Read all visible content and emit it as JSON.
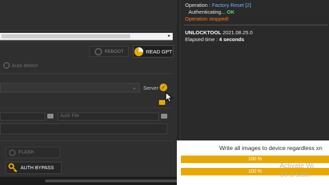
{
  "left_panel": {
    "reboot_label": "REBOOT",
    "read_gpt_label": "READ GPT",
    "auto_detect_label": "Auto detect",
    "server_label": "Server",
    "auth_file_placeholder": "Auth File",
    "flash_label": "FLASH",
    "auth_bypass_label": "AUTH BYPASS"
  },
  "log": {
    "operation_label": "Operation : ",
    "operation_value": "Factory Reset [2]",
    "authenticating_label": "Authenticating... ",
    "authenticating_status": "OK",
    "stopped_message": "Operation stopped!",
    "tool_name": "UNLOCKTOOL",
    "tool_version": " 2021.08.25.0",
    "elapsed_label": "Elapsed time : ",
    "elapsed_value": "4 seconds"
  },
  "status": {
    "message": "Write all images to device regardless xn",
    "progress_1": "100 %",
    "progress_1_fraction": 1.0,
    "progress_2": "100 %",
    "progress_2_fraction": 1.0
  },
  "watermark": {
    "line1": "Activate Wi",
    "line2": "Go to Settin"
  },
  "colors": {
    "accent_orange": "#e9a800",
    "log_blue": "#6fb5ff",
    "ok_green": "#6cd26c",
    "stopped_orange": "#ff7a1a"
  }
}
